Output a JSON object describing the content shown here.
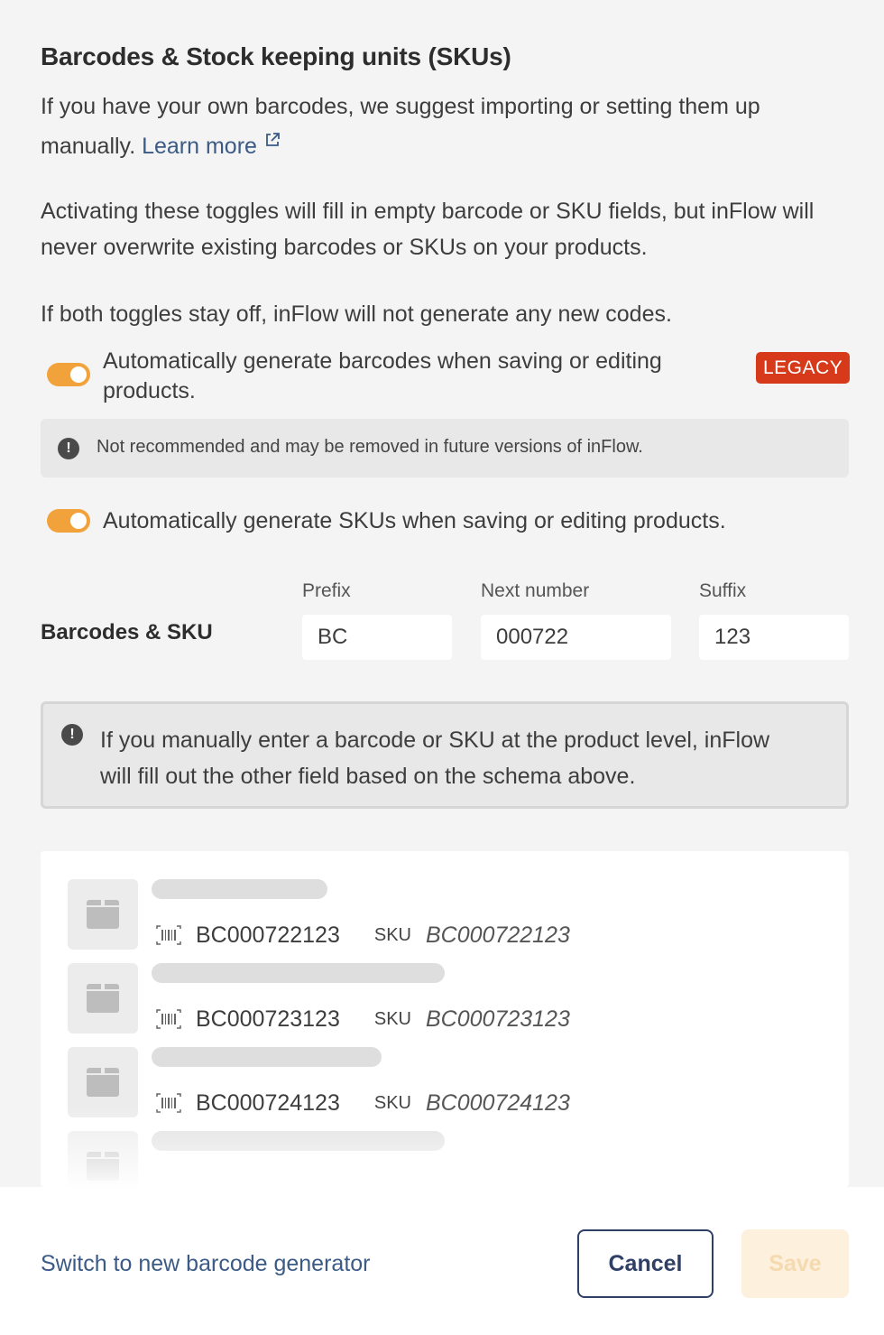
{
  "section": {
    "title": "Barcodes & Stock keeping units (SKUs)",
    "intro_text": "If you have your own barcodes, we suggest importing or setting them up manually.",
    "learn_more_label": "Learn more",
    "toggles_text": "Activating these toggles will fill in empty barcode or SKU fields, but inFlow will never overwrite existing barcodes or SKUs on your products.",
    "both_off_text": "If both toggles stay off, inFlow will not generate any new codes."
  },
  "toggles": {
    "barcodes": {
      "label": "Automatically generate barcodes when saving or editing products.",
      "on": true,
      "badge": "LEGACY"
    },
    "barcodes_warning": "Not recommended and may be removed in future versions of inFlow.",
    "skus": {
      "label": "Automatically generate SKUs when saving or editing products.",
      "on": true
    }
  },
  "schema": {
    "row_label": "Barcodes & SKU",
    "prefix_label": "Prefix",
    "prefix_value": "BC",
    "next_number_label": "Next number",
    "next_number_value": "000722",
    "suffix_label": "Suffix",
    "suffix_value": "123"
  },
  "manual_note": "If you manually enter a barcode or SKU at the product level, inFlow will fill out the other field based on the schema above.",
  "preview": {
    "sku_tag": "SKU",
    "rows": [
      {
        "barcode": "BC000722123",
        "sku": "BC000722123"
      },
      {
        "barcode": "BC000723123",
        "sku": "BC000723123"
      },
      {
        "barcode": "BC000724123",
        "sku": "BC000724123"
      }
    ]
  },
  "footer": {
    "switch_link": "Switch to new barcode generator",
    "cancel_label": "Cancel",
    "save_label": "Save"
  },
  "colors": {
    "toggle_on": "#f2a23a",
    "legacy_badge": "#d63a1b",
    "link": "#3b5a86",
    "cancel_border": "#2f3f66",
    "save_disabled_bg": "#fdf0dc"
  }
}
